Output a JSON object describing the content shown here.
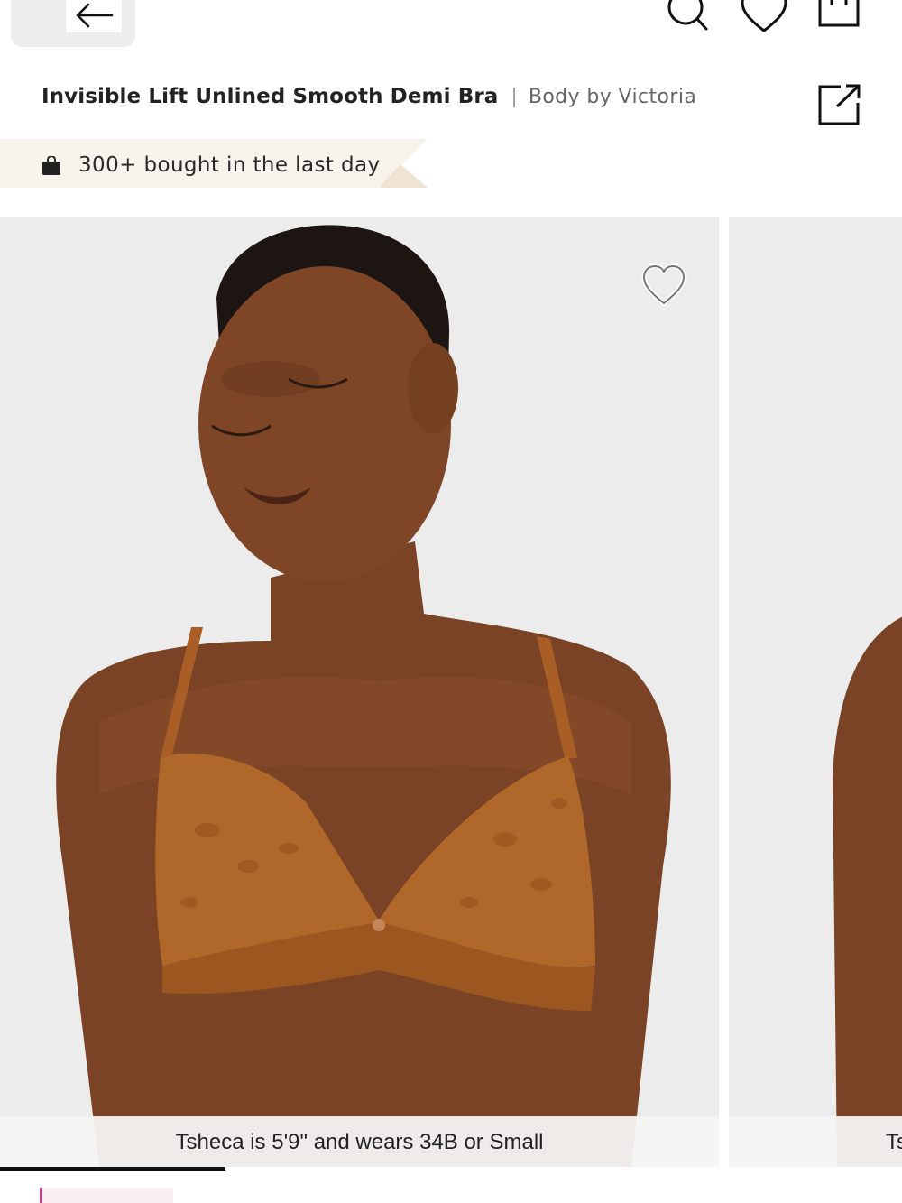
{
  "header": {
    "back_icon": "arrow-left-icon",
    "search_icon": "search-icon",
    "wishlist_icon": "heart-icon",
    "bag_icon": "shopping-bag-icon"
  },
  "product": {
    "title": "Invisible Lift Unlined Smooth Demi Bra",
    "separator": "|",
    "brand": "Body by Victoria",
    "share_icon": "share-icon"
  },
  "social_proof": {
    "icon": "shopping-bag-icon",
    "text": "300+ bought in the last day",
    "background": "#f6f2ec",
    "accent": "#efe4d4"
  },
  "gallery": {
    "slides": [
      {
        "caption": "Tsheca  is 5'9\" and wears 34B or Small",
        "favorite_icon": "heart-outline-icon"
      },
      {
        "caption": "Ts"
      }
    ],
    "progress": 0.25
  },
  "colors": {
    "bra": "#b0672a",
    "skin": "#7a4325",
    "badge_accent": "#d13c8a"
  }
}
